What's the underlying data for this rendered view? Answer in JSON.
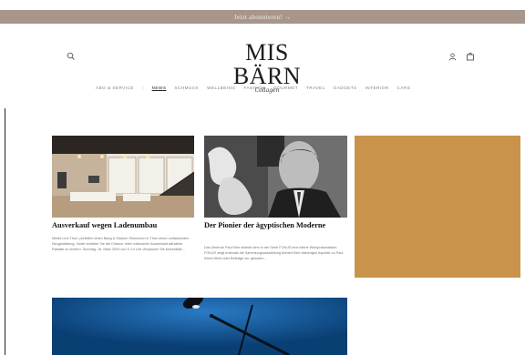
{
  "announcement": {
    "text": "Jetzt abonnieren! →"
  },
  "header": {
    "logo_main": "MIS BÄRN",
    "logo_sub": "Collagen",
    "icons": [
      "search-icon",
      "account-icon",
      "cart-icon"
    ]
  },
  "nav": {
    "items": [
      {
        "label": "ABO & SERVICE"
      },
      {
        "label": "NEWS"
      },
      {
        "label": "SCHMUCK"
      },
      {
        "label": "WELLBEING"
      },
      {
        "label": "FASHION"
      },
      {
        "label": "GOURMET"
      },
      {
        "label": "TRAVEL"
      },
      {
        "label": "GADGETS"
      },
      {
        "label": "INTERIOR"
      },
      {
        "label": "CARS"
      }
    ],
    "active": "NEWS"
  },
  "articles": [
    {
      "title": "Ausverkauf wegen Ladenumbau",
      "excerpt": "Media Line Thun: pünktlich einen Bang & Olufsen Showroom in Thun einen umfassenden Neugestaltung. Vorab erhalten Sie die Chance, beim exklusiven Ausverkauf attraktive Rabatte zu sichern: Sonntag, 16. März 2024 von 9–14 Uhr Verpassen Sie keinesfalls…"
    },
    {
      "title": "Der Pionier der ägyptischen Moderne",
      "excerpt": "Das Zentrum Paul Klee widmet dem in der Serie FOKUS eine kleine Werkpräsentation. FOKUS zeigt erstmals die Sammlungsausstellung Ahmed Klee bisherigen Aspekte zu Paul Klees Werk oder Beiträge zur globalen…"
    }
  ],
  "colors": {
    "announcement_bg": "#a8968a",
    "ad_block": "#c9934c",
    "bottom_image": "#0f4f86"
  }
}
